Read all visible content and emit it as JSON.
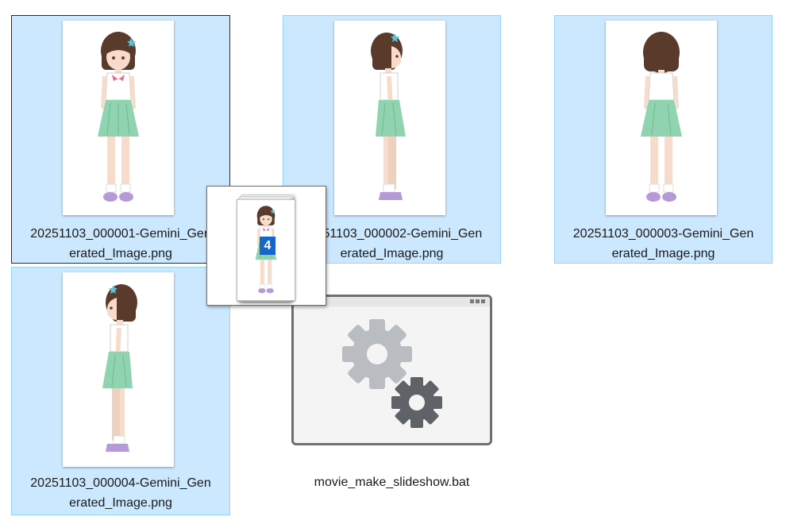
{
  "files": [
    {
      "name_line1": "20251103_000001-Gemini_Gen",
      "name_line2": "erated_Image.png",
      "view": "front",
      "focused": true
    },
    {
      "name_line1": "20251103_000002-Gemini_Gen",
      "name_line2": "erated_Image.png",
      "view": "side-left",
      "focused": false
    },
    {
      "name_line1": "20251103_000003-Gemini_Gen",
      "name_line2": "erated_Image.png",
      "view": "back",
      "focused": false
    },
    {
      "name_line1": "20251103_000004-Gemini_Gen",
      "name_line2": "erated_Image.png",
      "view": "side-right",
      "focused": false
    }
  ],
  "batch_file": {
    "name": "movie_make_slideshow.bat",
    "icon": "gears-icon"
  },
  "drag_ghost": {
    "count": "4"
  },
  "colors": {
    "selection_bg": "#cce8ff",
    "selection_border": "#99d1ff",
    "badge": "#1766c7",
    "skirt": "#8fd3b0",
    "hair": "#5a3a2a"
  }
}
